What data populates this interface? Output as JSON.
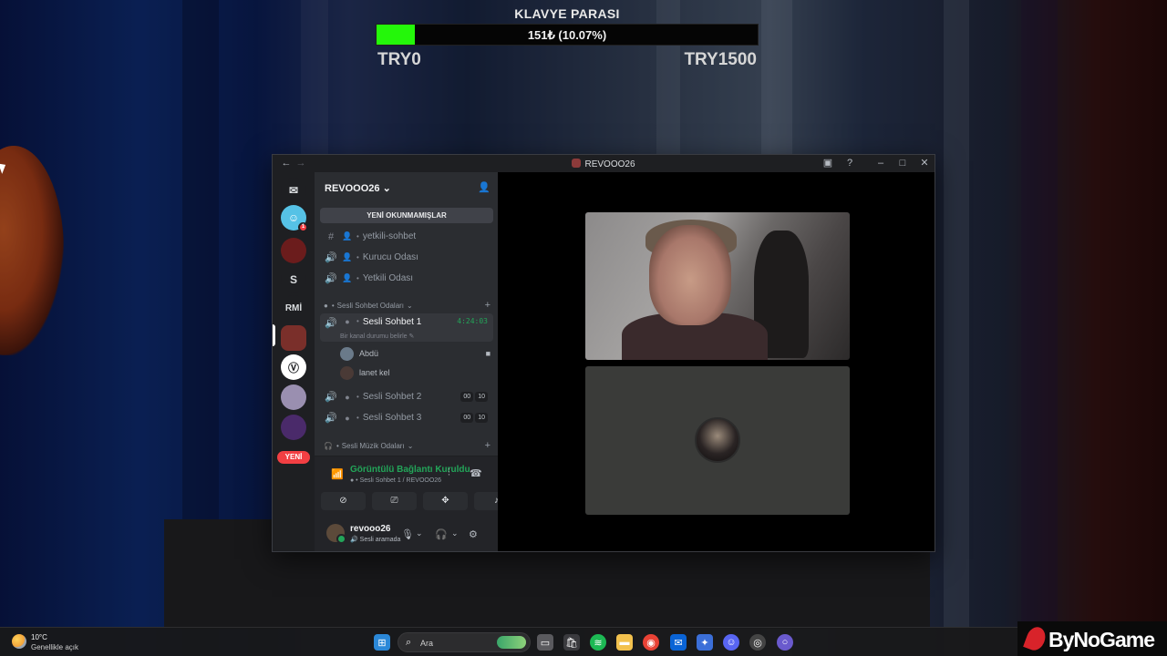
{
  "overlay": {
    "title": "KLAVYE PARASI",
    "progress_text": "151₺ (10.07%)",
    "progress_fraction": 0.1007,
    "min_label": "TRY0",
    "max_label": "TRY1500",
    "fill_color": "#24f70a"
  },
  "window": {
    "title": "REVOOO26",
    "back_icon": "arrow-left-icon",
    "forward_icon": "arrow-right-icon"
  },
  "rail": {
    "new_label": "YENİ",
    "servers": [
      {
        "label": "",
        "icon": "discord-logo-icon"
      },
      {
        "label": "",
        "icon": "smiley-avatar"
      },
      {
        "label": "",
        "icon": "server-icon"
      },
      {
        "label": "S",
        "icon": ""
      },
      {
        "label": "RMİ",
        "icon": ""
      },
      {
        "label": "",
        "icon": "server-icon"
      },
      {
        "label": "",
        "icon": "server-icon"
      },
      {
        "label": "",
        "icon": "server-icon"
      },
      {
        "label": "",
        "icon": "server-icon"
      }
    ],
    "dm_badge": "1"
  },
  "channels": {
    "server_name": "REVOOO26",
    "unread_button": "YENİ OKUNMAMIŞLAR",
    "top_channels": [
      {
        "name": "yetkili-sohbet",
        "type": "text"
      },
      {
        "name": "Kurucu Odası",
        "type": "voice"
      },
      {
        "name": "Yetkili Odası",
        "type": "voice"
      }
    ],
    "category_voice": "Sesli Sohbet Odaları",
    "active_channel": {
      "name": "Sesli Sohbet 1",
      "timer": "4:24:03",
      "status": "Bir kanal durumu belirle"
    },
    "voice_users": [
      {
        "name": "Abdü"
      },
      {
        "name": "lanet kel"
      }
    ],
    "other_channels": [
      {
        "name": "Sesli Sohbet 2",
        "count": "00",
        "limit": "10"
      },
      {
        "name": "Sesli Sohbet 3",
        "count": "00",
        "limit": "10"
      }
    ],
    "category_music": "Sesli Müzik Odaları"
  },
  "rtc": {
    "title": "Görüntülü Bağlantı Kuruldu",
    "subtitle": "Sesli Sohbet 1 / REVOOO26"
  },
  "user": {
    "name": "revooo26",
    "status": "Sesli aramada"
  },
  "taskbar": {
    "temperature": "10°C",
    "weather": "Genellikle açık",
    "search_placeholder": "Ara"
  },
  "brand": {
    "name": "ByNoGame"
  }
}
